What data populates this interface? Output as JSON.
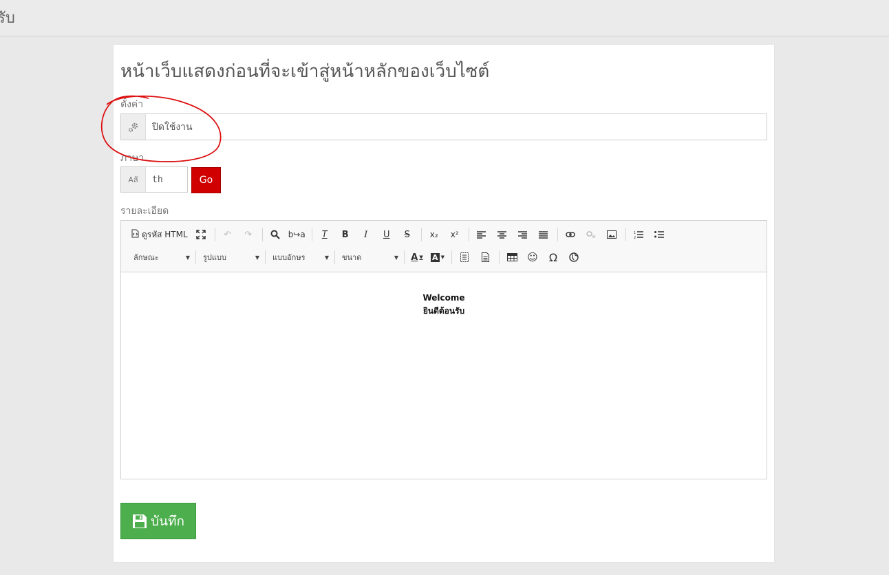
{
  "topbar": {
    "partial_text": "รับ"
  },
  "page": {
    "title": "หน้าเว็บแสดงก่อนที่จะเข้าสู่หน้าหลักของเว็บไซต์"
  },
  "settings": {
    "label": "ตั้งค่า",
    "value": "ปิดใช้งาน",
    "icon": "gears-icon"
  },
  "language": {
    "label": "ภาษา",
    "icon_text": "Aลั",
    "value": "th",
    "go_label": "Go"
  },
  "details": {
    "label": "รายละเอียด"
  },
  "toolbar": {
    "source_label": "ดูรหัส HTML",
    "combos": {
      "style": "ลักษณะ",
      "format": "รูปแบบ",
      "font": "แบบอักษร",
      "size": "ขนาด"
    }
  },
  "editor_content": {
    "line1": "Welcome",
    "line2": "ยินดีต้อนรับ"
  },
  "save": {
    "label": "บันทึก"
  },
  "colors": {
    "go_button": "#d00000",
    "save_button": "#4cae4c",
    "annotation_circle": "#dd1111"
  }
}
